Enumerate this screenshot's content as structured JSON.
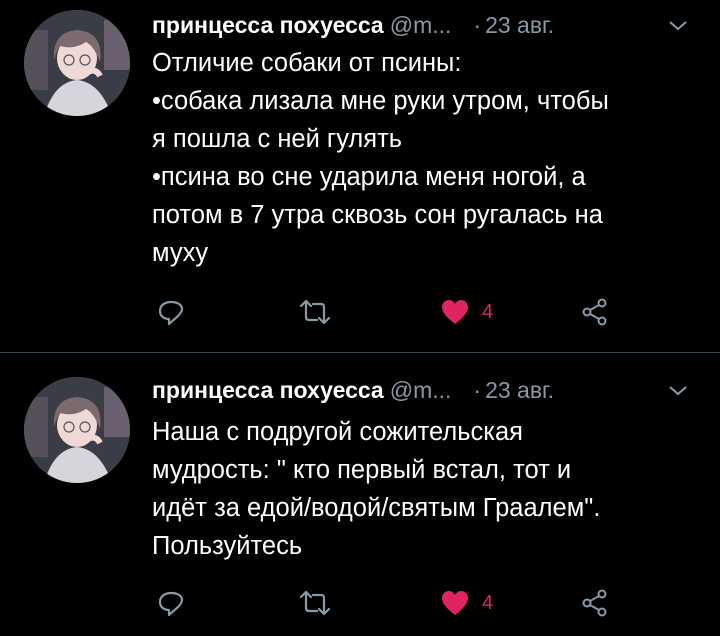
{
  "tweets": [
    {
      "author": "принцесса похуесса",
      "handle": "@m...",
      "separator": "·",
      "date": "23 авг.",
      "lines": [
        "Отличие собаки от псины:",
        "•собака лизала мне руки утром, чтобы",
        "я пошла с ней гулять",
        "•псина во сне ударила меня ногой, а",
        "потом в 7 утра сквозь сон ругалась на",
        "муху"
      ],
      "likes": "4"
    },
    {
      "author": "принцесса похуесса",
      "handle": "@m...",
      "separator": "·",
      "date": "23 авг.",
      "lines": [
        "Наша с подругой сожительская",
        "мудрость: \" кто первый встал, тот и",
        "идёт за едой/водой/святым Граалем\".",
        "Пользуйтесь"
      ],
      "likes": "4"
    }
  ],
  "icons": {
    "reply": "reply-icon",
    "retweet": "retweet-icon",
    "like": "heart-icon",
    "share": "share-icon",
    "menu": "chevron-down-icon"
  },
  "colors": {
    "background": "#000000",
    "text": "#ffffff",
    "secondary": "#8899a6",
    "like": "#e0245e",
    "divider": "#38444d"
  }
}
